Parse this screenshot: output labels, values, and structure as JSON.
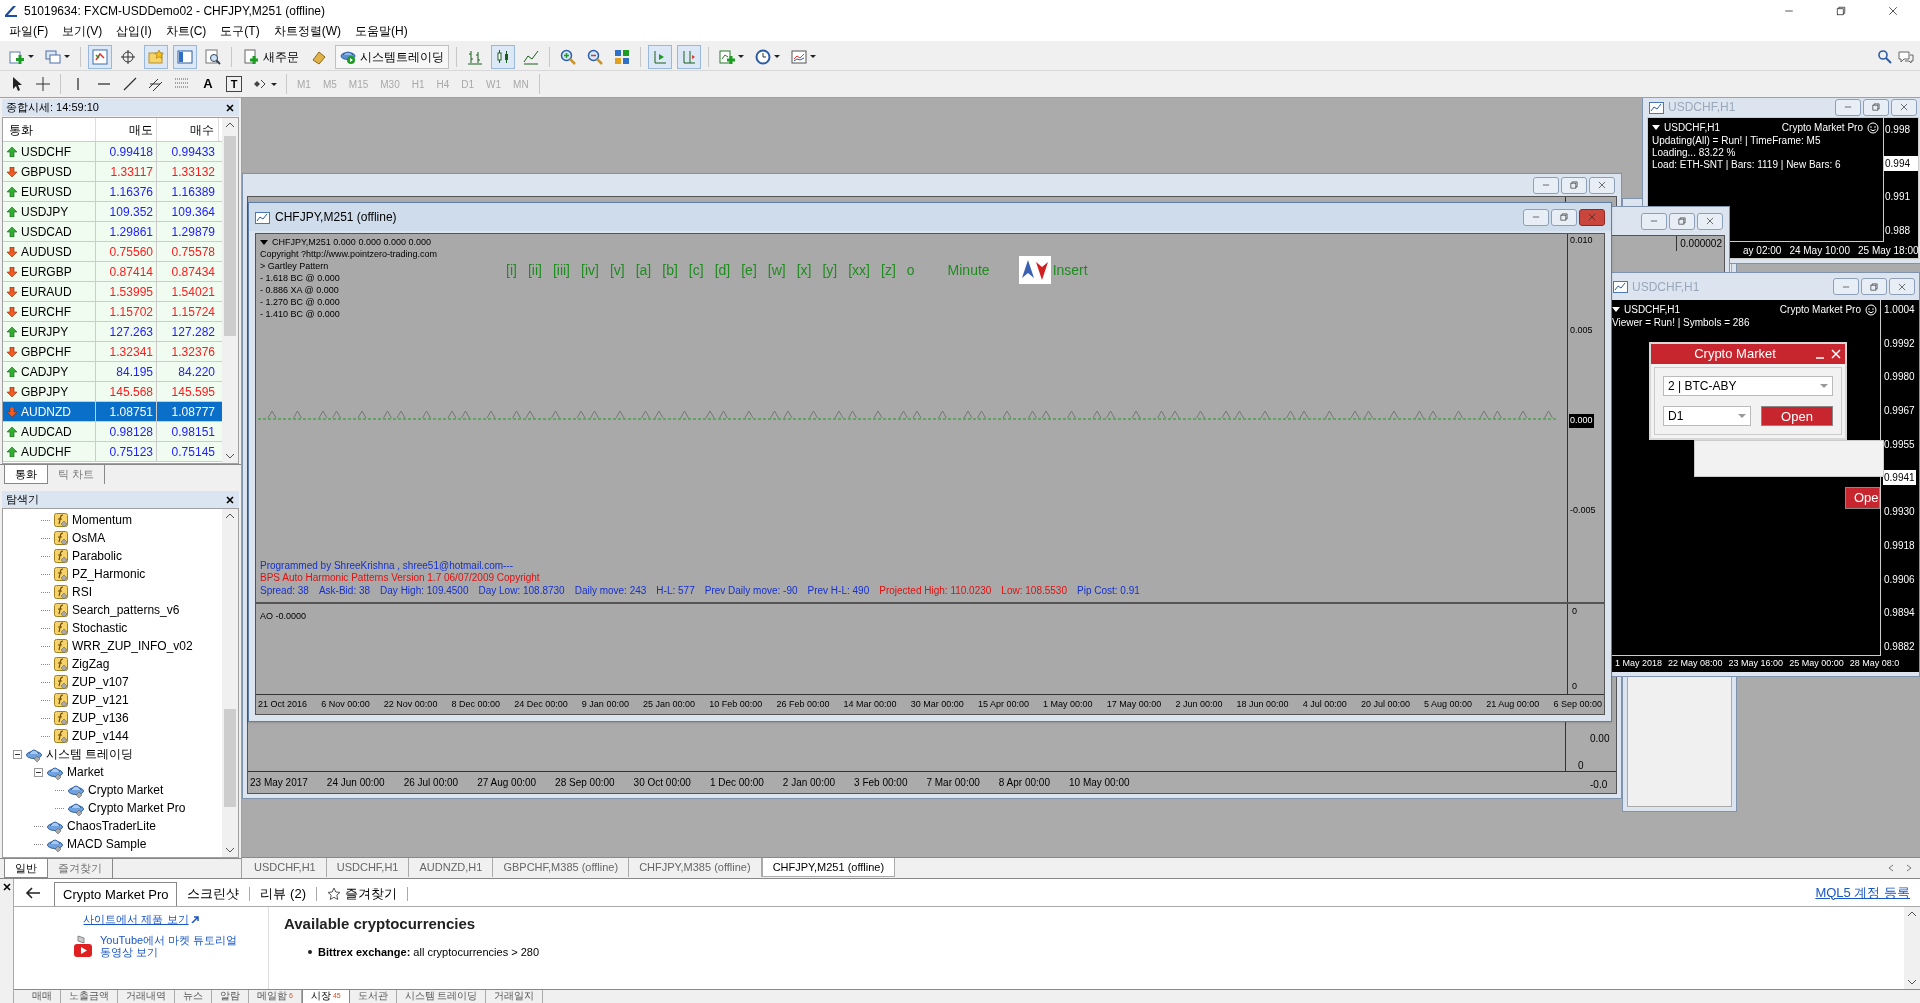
{
  "window": {
    "title": "51019634: FXCM-USDDemo02 - CHFJPY,M251 (offline)"
  },
  "menu": [
    "파일(F)",
    "보기(V)",
    "삽입(I)",
    "차트(C)",
    "도구(T)",
    "차트정렬(W)",
    "도움말(H)"
  ],
  "toolbar": {
    "new_order": "새주문",
    "system_trading": "시스템트레이딩",
    "text_tool": "A",
    "label_tool": "T",
    "timeframes": [
      {
        "label": "M1",
        "disabled": true
      },
      {
        "label": "M5",
        "disabled": true
      },
      {
        "label": "M15",
        "disabled": true
      },
      {
        "label": "M30",
        "disabled": true
      },
      {
        "label": "H1",
        "disabled": true
      },
      {
        "label": "H4",
        "disabled": true
      },
      {
        "label": "D1",
        "disabled": true
      },
      {
        "label": "W1",
        "disabled": true
      },
      {
        "label": "MN",
        "disabled": true
      }
    ]
  },
  "market_watch": {
    "title": "종합시세: 14:59:10",
    "columns": [
      "통화",
      "매도",
      "매수"
    ],
    "rows": [
      {
        "symbol": "USDCHF",
        "bid": "0.99418",
        "ask": "0.99433",
        "rising": true,
        "selected": false
      },
      {
        "symbol": "GBPUSD",
        "bid": "1.33117",
        "ask": "1.33132",
        "rising": false,
        "selected": false
      },
      {
        "symbol": "EURUSD",
        "bid": "1.16376",
        "ask": "1.16389",
        "rising": true,
        "selected": false
      },
      {
        "symbol": "USDJPY",
        "bid": "109.352",
        "ask": "109.364",
        "rising": true,
        "selected": false
      },
      {
        "symbol": "USDCAD",
        "bid": "1.29861",
        "ask": "1.29879",
        "rising": true,
        "selected": false
      },
      {
        "symbol": "AUDUSD",
        "bid": "0.75560",
        "ask": "0.75578",
        "rising": false,
        "selected": false
      },
      {
        "symbol": "EURGBP",
        "bid": "0.87414",
        "ask": "0.87434",
        "rising": false,
        "selected": false
      },
      {
        "symbol": "EURAUD",
        "bid": "1.53995",
        "ask": "1.54021",
        "rising": false,
        "selected": false
      },
      {
        "symbol": "EURCHF",
        "bid": "1.15702",
        "ask": "1.15724",
        "rising": false,
        "selected": false
      },
      {
        "symbol": "EURJPY",
        "bid": "127.263",
        "ask": "127.282",
        "rising": true,
        "selected": false
      },
      {
        "symbol": "GBPCHF",
        "bid": "1.32341",
        "ask": "1.32376",
        "rising": false,
        "selected": false
      },
      {
        "symbol": "CADJPY",
        "bid": "84.195",
        "ask": "84.220",
        "rising": true,
        "selected": false
      },
      {
        "symbol": "GBPJPY",
        "bid": "145.568",
        "ask": "145.595",
        "rising": false,
        "selected": false
      },
      {
        "symbol": "AUDNZD",
        "bid": "1.08751",
        "ask": "1.08777",
        "rising": false,
        "selected": true
      },
      {
        "symbol": "AUDCAD",
        "bid": "0.98128",
        "ask": "0.98151",
        "rising": true,
        "selected": false
      },
      {
        "symbol": "AUDCHF",
        "bid": "0.75123",
        "ask": "0.75145",
        "rising": true,
        "selected": false
      }
    ],
    "tabs": [
      {
        "label": "통화",
        "selected": true
      },
      {
        "label": "틱 차트",
        "selected": false
      }
    ]
  },
  "navigator": {
    "title": "탐색기",
    "indicators": [
      "Momentum",
      "OsMA",
      "Parabolic",
      "PZ_Harmonic",
      "RSI",
      "Search_patterns_v6",
      "Stochastic",
      "WRR_ZUP_INFO_v02",
      "ZigZag",
      "ZUP_v107",
      "ZUP_v121",
      "ZUP_v136",
      "ZUP_v144"
    ],
    "tree": [
      {
        "label": "시스템 트레이딩",
        "expanded": true,
        "children": [
          {
            "label": "Market",
            "expanded": true,
            "children": [
              {
                "label": "Crypto Market"
              },
              {
                "label": "Crypto Market Pro"
              }
            ]
          },
          {
            "label": "ChaosTraderLite"
          },
          {
            "label": "MACD Sample"
          }
        ]
      }
    ],
    "tabs": [
      {
        "label": "일반",
        "selected": true
      },
      {
        "label": "즐겨찾기",
        "selected": false
      }
    ]
  },
  "back_window": {
    "price_ticks": [
      "0.00",
      "0",
      "-0.0"
    ],
    "date_ticks": [
      "23 May 2017",
      "24 Jun 00:00",
      "26 Jul 00:00",
      "27 Aug 00:00",
      "28 Sep 00:00",
      "30 Oct 00:00",
      "1 Dec 00:00",
      "2 Jan 00:00",
      "3 Feb 00:00",
      "7 Mar 00:00",
      "8 Apr 00:00",
      "10 May 00:00"
    ]
  },
  "main_chart": {
    "title": "CHFJPY,M251 (offline)",
    "legend": [
      "CHFJPY,M251  0.000 0.000 0.000 0.000",
      "Copyright ?http://www.pointzero-trading.com",
      "> Gartley Pattern",
      "- 1.618 BC @ 0.000",
      "- 0.886 XA @ 0.000",
      "- 1.270 BC @ 0.000",
      "- 1.410 BC @ 0.000"
    ],
    "wave_labels": [
      "[i]",
      "[ii]",
      "[iii]",
      "[iv]",
      "[v]",
      "[a]",
      "[b]",
      "[c]",
      "[d]",
      "[e]",
      "[w]",
      "[x]",
      "[y]",
      "[xx]",
      "[z]",
      "o"
    ],
    "degree": "Minute",
    "insert": "Insert",
    "footer": {
      "credit": "Programmed by ShreeKrishna ,  shree51@hotmail.com---",
      "version": "BPS Auto Harmonic Patterns Version 1.7 06/07/2009    Copyright",
      "stats": [
        {
          "text": "Spread:  38",
          "kind": "info"
        },
        {
          "text": "Ask-Bid:  38",
          "kind": "info"
        },
        {
          "text": "Day High:  109.4500",
          "kind": "info"
        },
        {
          "text": "Day Low:  108.8730",
          "kind": "info"
        },
        {
          "text": "Daily move:  243",
          "kind": "info"
        },
        {
          "text": "H-L:  577",
          "kind": "info"
        },
        {
          "text": "Prev Daily move:  -90",
          "kind": "info"
        },
        {
          "text": "Prev H-L:  490",
          "kind": "info"
        },
        {
          "text": "Projected High:  110.0230",
          "kind": "projection"
        },
        {
          "text": "Low:  108.5530",
          "kind": "projection"
        },
        {
          "text": "Pip Cost:  0.91",
          "kind": "info"
        }
      ]
    },
    "price_ticks": [
      {
        "label": "0.010",
        "current": false
      },
      {
        "label": "0.005",
        "current": false
      },
      {
        "label": "0.000",
        "current": true
      },
      {
        "label": "-0.005",
        "current": false
      }
    ],
    "indicator_label": "AO -0.0000",
    "indicator_ticks": [
      "0",
      "0"
    ],
    "date_ticks": [
      "21 Oct 2016",
      "6 Nov 00:00",
      "22 Nov 00:00",
      "8 Dec 00:00",
      "24 Dec 00:00",
      "9 Jan 00:00",
      "25 Jan 00:00",
      "10 Feb 00:00",
      "26 Feb 00:00",
      "14 Mar 00:00",
      "30 Mar 00:00",
      "15 Apr 00:00",
      "1 May 00:00",
      "17 May 00:00",
      "2 Jun 00:00",
      "18 Jun 00:00",
      "4 Jul 00:00",
      "20 Jul 00:00",
      "5 Aug 00:00",
      "21 Aug 00:00",
      "6 Sep 00:00"
    ]
  },
  "small_window": {
    "value": "0.000002"
  },
  "top_right_chart": {
    "title": "USDCHF,H1",
    "symbol": "USDCHF,H1",
    "indicator": "Crypto Market Pro",
    "lines": [
      "Updating(All) = Run! | TimeFrame: M5",
      "Loading... 83.22 %",
      "Load: ETH-SNT | Bars: 1119 | New Bars: 6"
    ],
    "price_ticks": [
      {
        "label": "0.998",
        "current": false
      },
      {
        "label": "0.994",
        "current": true
      },
      {
        "label": "0.991",
        "current": false
      },
      {
        "label": "0.988",
        "current": false
      }
    ],
    "date_ticks": [
      "ay 02:00",
      "24 May 10:00",
      "25 May 18:00"
    ]
  },
  "viewer_chart": {
    "title": "USDCHF,H1",
    "symbol": "USDCHF,H1",
    "indicator": "Crypto Market Pro",
    "lines": [
      "Viewer = Run! | Symbols = 286"
    ],
    "price_ticks": [
      {
        "label": "1.0004",
        "current": false
      },
      {
        "label": "0.9992",
        "current": false
      },
      {
        "label": "0.9980",
        "current": false
      },
      {
        "label": "0.9967",
        "current": false
      },
      {
        "label": "0.9955",
        "current": false
      },
      {
        "label": "0.9941",
        "current": true
      },
      {
        "label": "0.9930",
        "current": false
      },
      {
        "label": "0.9918",
        "current": false
      },
      {
        "label": "0.9906",
        "current": false
      },
      {
        "label": "0.9894",
        "current": false
      },
      {
        "label": "0.9882",
        "current": false
      }
    ],
    "date_ticks": [
      "1 May 2018",
      "22 May 08:00",
      "23 May 16:00",
      "25 May 00:00",
      "28 May 08:0"
    ],
    "dialog": {
      "title": "Crypto Market",
      "symbol": "2 | BTC-ABY",
      "timeframe": "D1",
      "button": "Open"
    },
    "cut_button": "Ope"
  },
  "chart_tabs": [
    {
      "label": "USDCHF,H1",
      "selected": false
    },
    {
      "label": "USDCHF,H1",
      "selected": false
    },
    {
      "label": "AUDNZD,H1",
      "selected": false
    },
    {
      "label": "GBPCHF,M385 (offline)",
      "selected": false
    },
    {
      "label": "CHFJPY,M385 (offline)",
      "selected": false
    },
    {
      "label": "CHFJPY,M251 (offline)",
      "selected": true
    }
  ],
  "terminal": {
    "tabs": [
      {
        "label": "Crypto Market Pro",
        "selected": true,
        "kind": "plain"
      },
      {
        "label": "스크린샷",
        "selected": false,
        "kind": "plain"
      },
      {
        "label": "리뷰 (2)",
        "selected": false,
        "kind": "plain"
      },
      {
        "label": "즐겨찾기",
        "selected": false,
        "kind": "favorite"
      }
    ],
    "account_link": "MQL5 계정 등록",
    "side_links": [
      "사이트에서 제품 보기",
      "YouTube에서 마켓 튜토리얼 동영상 보기"
    ],
    "heading": "Available cryptocurrencies",
    "bullet": "**Bittrex exchange:** all cryptocurrencies > 280",
    "bottom_tabs": [
      {
        "label": "매매",
        "selected": false
      },
      {
        "label": "노출금액",
        "selected": false
      },
      {
        "label": "거래내역",
        "selected": false
      },
      {
        "label": "뉴스",
        "selected": false
      },
      {
        "label": "알람",
        "selected": false
      },
      {
        "label": "메일함",
        "selected": false,
        "badge": "6"
      },
      {
        "label": "시장",
        "selected": true,
        "badge": "45"
      },
      {
        "label": "도서관",
        "selected": false
      },
      {
        "label": "시스템 트레이딩",
        "selected": false
      },
      {
        "label": "거래일지",
        "selected": false
      }
    ]
  }
}
